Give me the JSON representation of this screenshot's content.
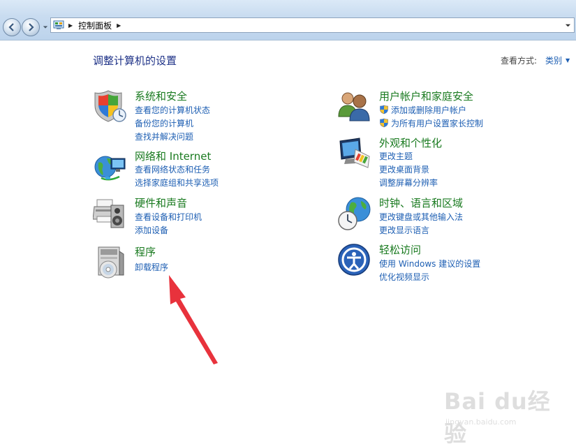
{
  "address_bar": {
    "crumb": "控制面板"
  },
  "header": {
    "title": "调整计算机的设置",
    "view_label": "查看方式:",
    "view_value": "类别"
  },
  "categories_left": [
    {
      "title": "系统和安全",
      "icon": "shield-icon",
      "links": [
        "查看您的计算机状态",
        "备份您的计算机",
        "查找并解决问题"
      ]
    },
    {
      "title": "网络和 Internet",
      "icon": "globe-network-icon",
      "links": [
        "查看网络状态和任务",
        "选择家庭组和共享选项"
      ]
    },
    {
      "title": "硬件和声音",
      "icon": "printer-speaker-icon",
      "links": [
        "查看设备和打印机",
        "添加设备"
      ]
    },
    {
      "title": "程序",
      "icon": "programs-disc-icon",
      "links": [
        "卸载程序"
      ]
    }
  ],
  "categories_right": [
    {
      "title": "用户帐户和家庭安全",
      "icon": "users-icon",
      "links": [
        "添加或删除用户帐户",
        "为所有用户设置家长控制"
      ]
    },
    {
      "title": "外观和个性化",
      "icon": "display-palette-icon",
      "links": [
        "更改主题",
        "更改桌面背景",
        "调整屏幕分辨率"
      ]
    },
    {
      "title": "时钟、语言和区域",
      "icon": "clock-globe-icon",
      "links": [
        "更改键盘或其他输入法",
        "更改显示语言"
      ]
    },
    {
      "title": "轻松访问",
      "icon": "ease-of-access-icon",
      "links": [
        "使用 Windows 建议的设置",
        "优化视频显示"
      ]
    }
  ],
  "watermark": {
    "text": "Bai du经验",
    "url": "jingyan.baidu.com"
  },
  "colors": {
    "category_title": "#197a1f",
    "link": "#1e5fb3",
    "page_title": "#1e3287",
    "annotation_arrow": "#e8323c"
  }
}
